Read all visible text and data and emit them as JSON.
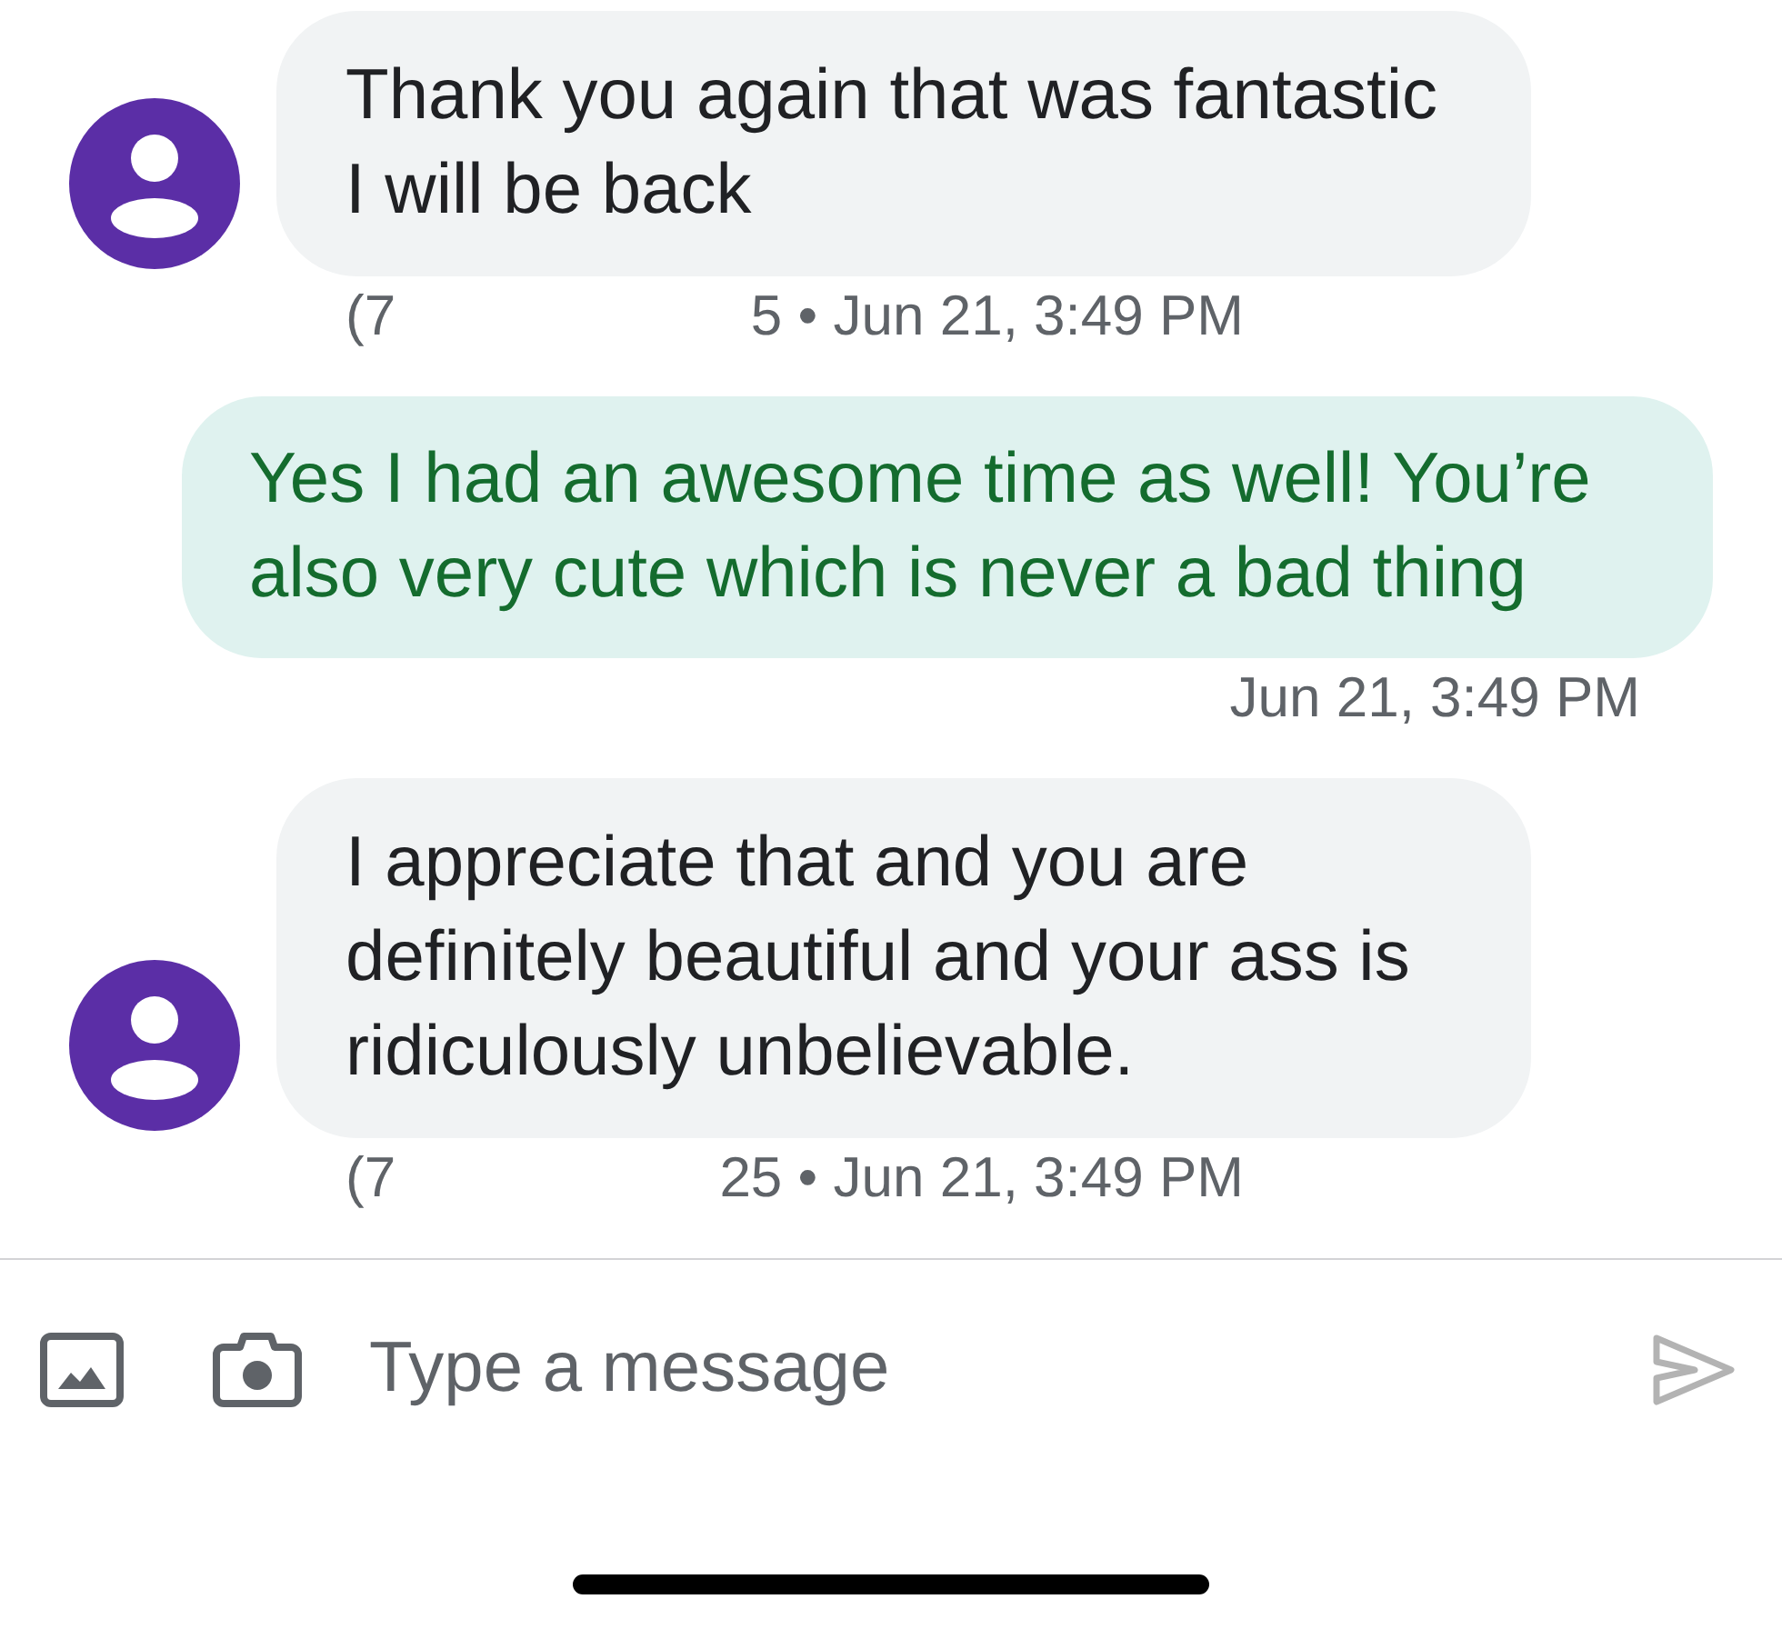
{
  "messages": [
    {
      "kind": "incoming",
      "text": "Thank you again that was fantastic I will be back",
      "caption_start": "(7",
      "caption_end": "5 • Jun 21, 3:49 PM"
    },
    {
      "kind": "outgoing",
      "text": "Yes I had an awesome time as well! You’re also very cute which is never a bad thing",
      "caption": "Jun 21, 3:49 PM"
    },
    {
      "kind": "incoming",
      "text": "I appreciate that and you are definitely beautiful and your ass is ridiculously unbelievable.",
      "caption_start": "(7",
      "caption_end": "25 • Jun 21, 3:49 PM"
    }
  ],
  "composer": {
    "placeholder": "Type a message"
  }
}
